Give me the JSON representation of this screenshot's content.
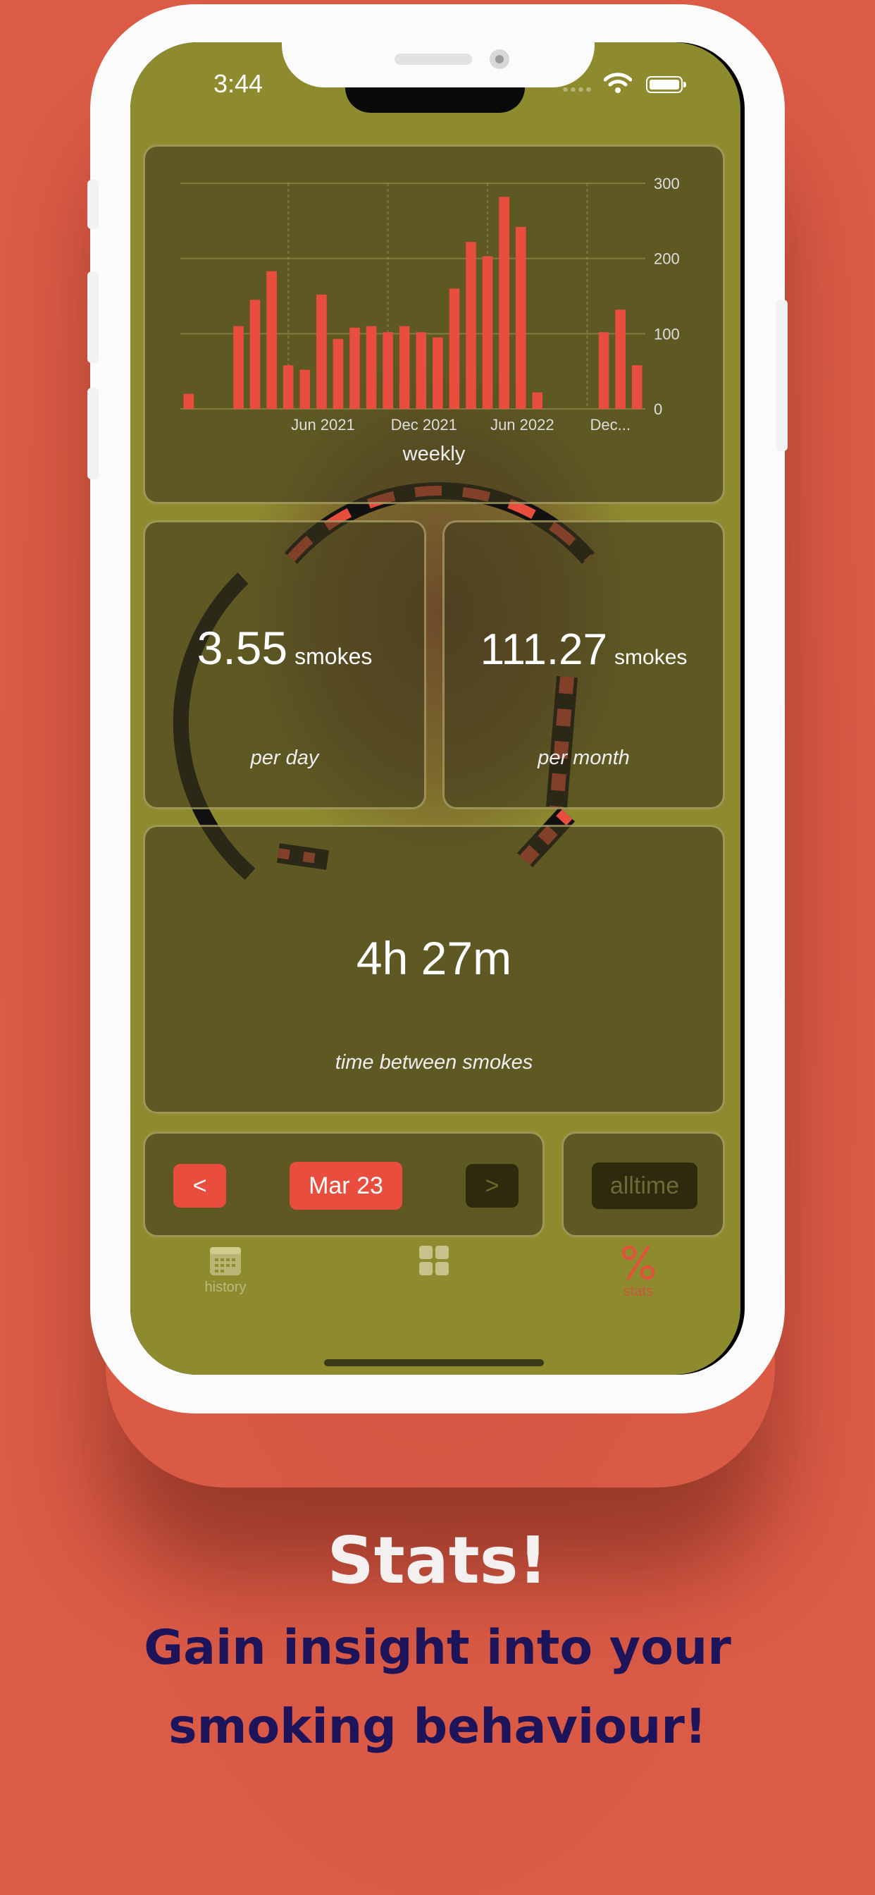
{
  "status_bar": {
    "time": "3:44"
  },
  "chart_data": {
    "type": "bar",
    "caption": "weekly",
    "y_ticks": [
      "300",
      "200",
      "100",
      "0"
    ],
    "x_ticks": [
      "Jun 2021",
      "Dec 2021",
      "Jun 2022",
      "Dec..."
    ],
    "ylim": [
      0,
      300
    ],
    "grid": true,
    "values": [
      20,
      0,
      0,
      110,
      145,
      183,
      58,
      52,
      152,
      93,
      108,
      110,
      102,
      110,
      102,
      95,
      160,
      222,
      203,
      282,
      242,
      22,
      0,
      0,
      0,
      102,
      132,
      58
    ],
    "bar_color": "#e94d3e"
  },
  "stats": {
    "per_day": {
      "value": "3.55",
      "unit": "smokes",
      "label": "per day"
    },
    "per_month": {
      "value": "111.27",
      "unit": "smokes",
      "label": "per month"
    },
    "between": {
      "value": "4h 27m",
      "label": "time between smokes"
    }
  },
  "period_nav": {
    "prev": "<",
    "current": "Mar 23",
    "next": ">",
    "alltime": "alltime"
  },
  "tabs": [
    {
      "label": "history",
      "icon": "calendar-icon"
    },
    {
      "label": "",
      "icon": "grid-icon"
    },
    {
      "label": "stats",
      "icon": "percent-icon"
    }
  ],
  "promo": {
    "title": "Stats!",
    "subtitle": "Gain insight into your smoking behaviour!"
  },
  "colors": {
    "background": "#dd5c47",
    "screen": "#8e8b2f",
    "accent": "#e94d3e",
    "subtitle": "#1e1459"
  }
}
